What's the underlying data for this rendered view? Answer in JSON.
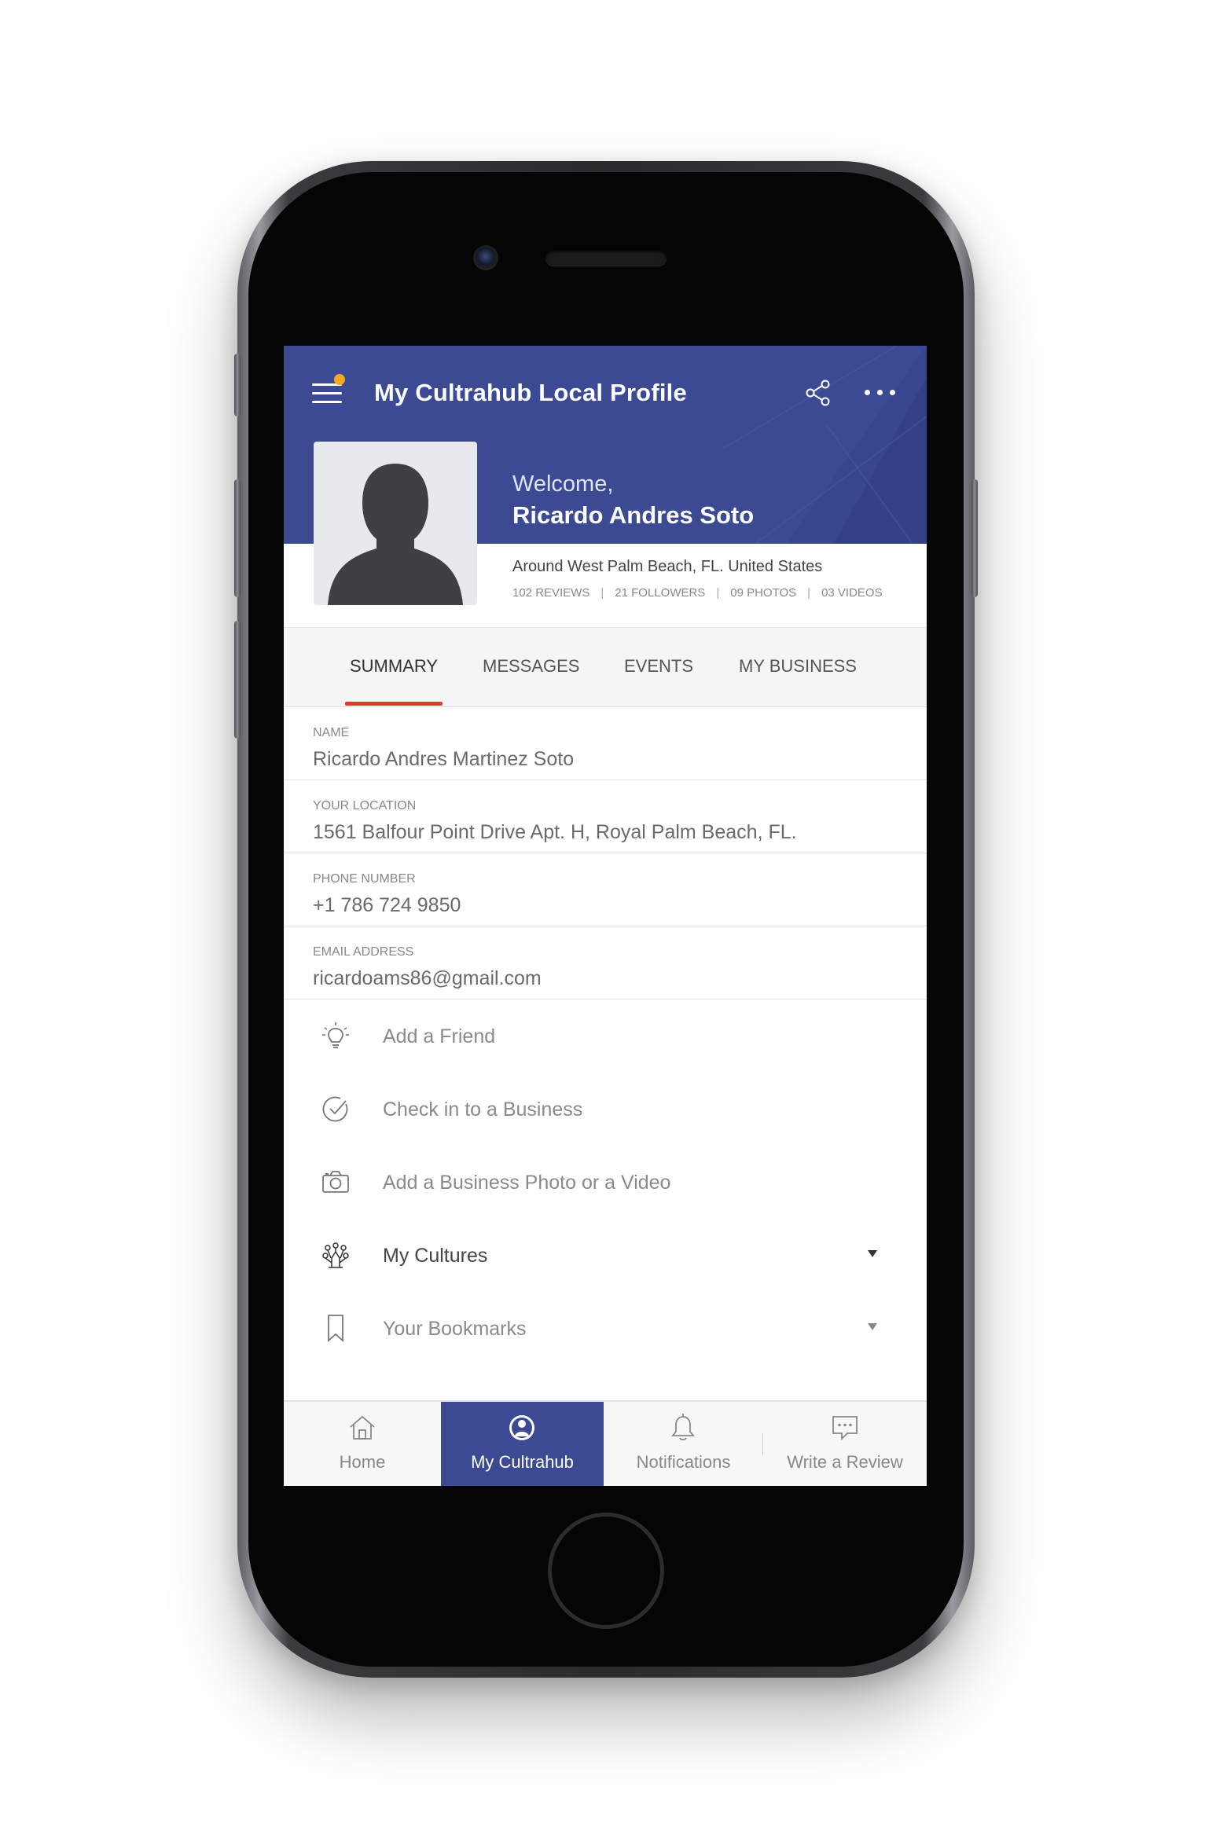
{
  "app": {
    "title": "My Cultrahub Local Profile",
    "accent_color": "#3c4a94",
    "notification_dot_color": "#f5a623",
    "tab_indicator_color": "#e03a2f"
  },
  "header": {
    "menu_icon": "hamburger-menu-icon",
    "share_icon": "share-icon",
    "more_icon": "more-horizontal-icon"
  },
  "profile": {
    "welcome": "Welcome,",
    "name": "Ricardo Andres Soto",
    "location": "Around West Palm Beach, FL. United States",
    "stats": {
      "reviews": "102 REVIEWS",
      "followers": "21 FOLLOWERS",
      "photos": "09 PHOTOS",
      "videos": "03 VIDEOS",
      "separator": "|"
    }
  },
  "tabs": [
    {
      "label": "SUMMARY",
      "active": true
    },
    {
      "label": "MESSAGES",
      "active": false
    },
    {
      "label": "EVENTS",
      "active": false
    },
    {
      "label": "MY BUSINESS",
      "active": false
    }
  ],
  "fields": [
    {
      "label": "NAME",
      "value": "Ricardo Andres Martinez Soto"
    },
    {
      "label": "YOUR LOCATION",
      "value": "1561 Balfour Point Drive Apt. H, Royal Palm Beach, FL."
    },
    {
      "label": "PHONE NUMBER",
      "value": "+1 786 724 9850"
    },
    {
      "label": "EMAIL ADDRESS",
      "value": "ricardoams86@gmail.com"
    }
  ],
  "actions": [
    {
      "label": "Add a Friend",
      "icon": "lightbulb-icon"
    },
    {
      "label": "Check in to a Business",
      "icon": "check-circle-icon"
    },
    {
      "label": "Add a Business Photo or a Video",
      "icon": "camera-icon"
    },
    {
      "label": "My Cultures",
      "icon": "cultures-icon",
      "expandable": true
    },
    {
      "label": "Your Bookmarks",
      "icon": "bookmark-icon",
      "expandable": true
    }
  ],
  "bottom_nav": [
    {
      "label": "Home",
      "icon": "home-icon",
      "active": false
    },
    {
      "label": "My Cultrahub",
      "icon": "profile-icon",
      "active": true
    },
    {
      "label": "Notifications",
      "icon": "bell-icon",
      "active": false
    },
    {
      "label": "Write a Review",
      "icon": "chat-bubble-icon",
      "active": false
    }
  ]
}
